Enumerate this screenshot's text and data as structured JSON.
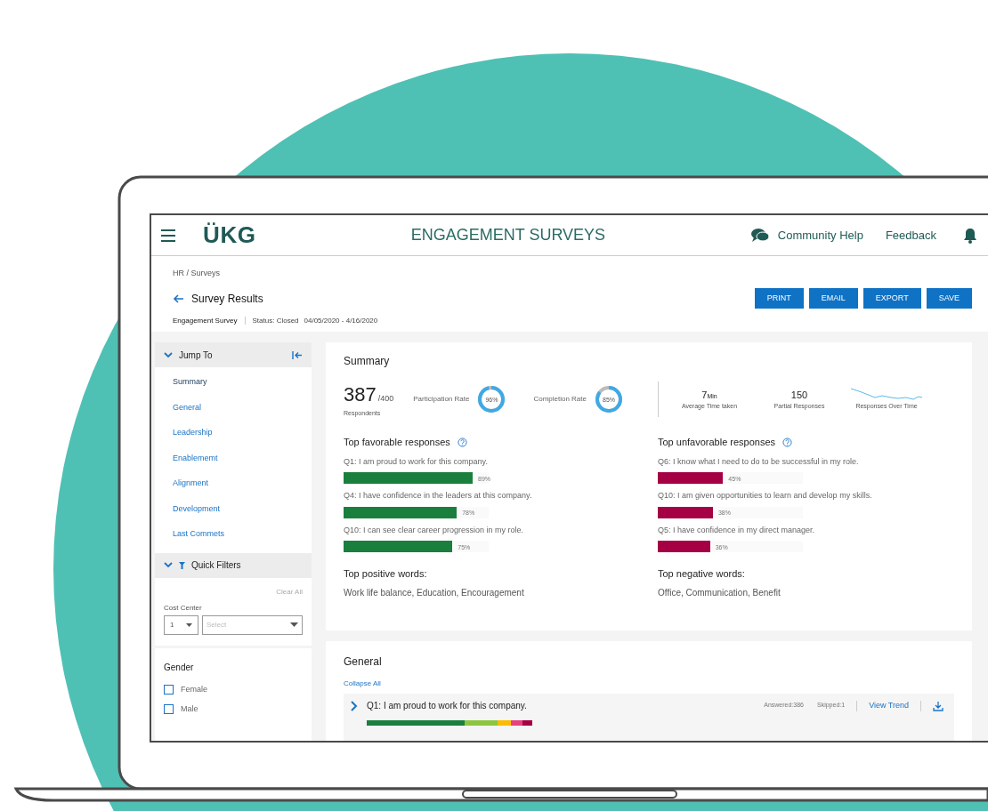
{
  "app": {
    "logo": "ÜKG",
    "title": "ENGAGEMENT SURVEYS",
    "help": "Community Help",
    "feedback": "Feedback"
  },
  "page": {
    "breadcrumb": "HR / Surveys",
    "title": "Survey Results",
    "survey": "Engagement Survey",
    "status": "Status: Closed",
    "dates": "04/05/2020 - 4/16/2020"
  },
  "actions": [
    "PRINT",
    "EMAIL",
    "EXPORT",
    "SAVE"
  ],
  "sidebar": {
    "jump_title": "Jump To",
    "items": [
      {
        "label": "Summary",
        "selected": true
      },
      {
        "label": "General",
        "selected": false
      },
      {
        "label": "Leadership",
        "selected": false
      },
      {
        "label": "Enablememt",
        "selected": false
      },
      {
        "label": "Alignment",
        "selected": false
      },
      {
        "label": "Development",
        "selected": false
      },
      {
        "label": "Last Commets",
        "selected": false
      }
    ],
    "filters_title": "Quick Filters",
    "clear": "Clear All",
    "cost_center": "Cost Center",
    "cost_value": "1",
    "select_placeholder": "Select",
    "gender_title": "Gender",
    "genders": [
      {
        "label": "Female",
        "checked": false
      },
      {
        "label": "Male",
        "checked": false
      }
    ]
  },
  "summary": {
    "title": "Summary",
    "respondents": "387",
    "total": "/400",
    "respondents_label": "Respondents",
    "rates": [
      {
        "label": "Participation Rate",
        "value": "96%",
        "level": 0.96
      },
      {
        "label": "Completion Rate",
        "value": "85%",
        "level": 0.85
      }
    ],
    "avg_time": "7",
    "avg_unit": "Min",
    "avg_label": "Average Time taken",
    "partial": "150",
    "partial_label": "Partial Responses",
    "trend_label": "Responses Over Time",
    "favorable": {
      "title": "Top favorable responses",
      "items": [
        {
          "question": "Q1: I am proud to work for this company.",
          "value": "89%",
          "level": 0.89
        },
        {
          "question": "Q4: I have confidence in the leaders at this company.",
          "value": "78%",
          "level": 0.78
        },
        {
          "question": "Q10: I can see clear career progression in my role.",
          "value": "75%",
          "level": 0.75
        }
      ],
      "words_title": "Top positive words:",
      "words": "Work life balance, Education, Encouragement"
    },
    "unfavorable": {
      "title": "Top unfavorable responses",
      "items": [
        {
          "question": "Q6: I know what I need to do to be successful in my role.",
          "value": "45%",
          "level": 0.45
        },
        {
          "question": "Q10: I am given opportunities to learn and develop my skills.",
          "value": "38%",
          "level": 0.38
        },
        {
          "question": "Q5: I have confidence in my direct manager.",
          "value": "36%",
          "level": 0.36
        }
      ],
      "words_title": "Top negative words:",
      "words": "Office, Communication, Benefit"
    }
  },
  "general": {
    "title": "General",
    "collapse": "Collapse All",
    "question": "Q1: I am proud to work for this company.",
    "answered": "Answered:386",
    "skipped": "Skipped:1",
    "trend": "View Trend"
  }
}
